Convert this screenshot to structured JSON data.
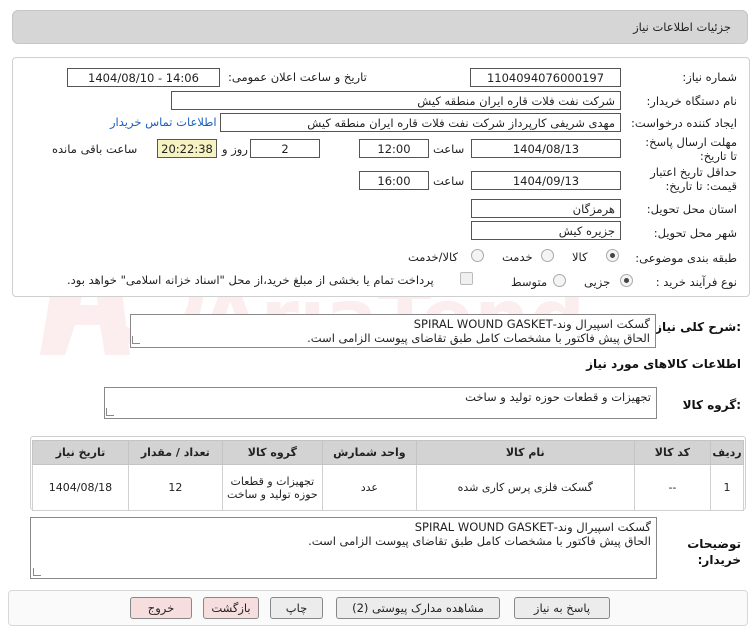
{
  "header": {
    "title": "جزئیات اطلاعات نیاز"
  },
  "form": {
    "need_number_label": "شماره نیاز:",
    "need_number": "1104094076000197",
    "announce_label": "تاریخ و ساعت اعلان عمومی:",
    "announce_value": "1404/08/10 - 14:06",
    "buyer_org_label": "نام دستگاه خریدار:",
    "buyer_org": "شرکت نفت فلات قاره ایران منطقه کیش",
    "creator_label": "ایجاد کننده درخواست:",
    "creator": "مهدی شریفی کارپرداز شرکت نفت فلات قاره ایران منطقه کیش",
    "contact_link": "اطلاعات تماس خریدار",
    "deadline_label": "مهلت ارسال پاسخ: تا تاریخ:",
    "deadline_date": "1404/08/13",
    "time_label": "ساعت",
    "deadline_time": "12:00",
    "days_value": "2",
    "days_label": "روز و",
    "remaining_time": "20:22:38",
    "remaining_label": "ساعت باقی مانده",
    "validity_label": "حداقل تاریخ اعتبار قیمت: تا تاریخ:",
    "validity_date": "1404/09/13",
    "validity_time_label": "ساعت",
    "validity_time": "16:00",
    "province_label": "استان محل تحویل:",
    "province": "هرمزگان",
    "city_label": "شهر محل تحویل:",
    "city": "جزیره کیش",
    "category_label": "طبقه بندی موضوعی:",
    "category_options": [
      "کالا",
      "خدمت",
      "کالا/خدمت"
    ],
    "process_label": "نوع فرآیند خرید :",
    "process_options": [
      "جزیی",
      "متوسط"
    ],
    "payment_note": "پرداخت تمام یا بخشی از مبلغ خرید،از محل \"اسناد خزانه اسلامی\" خواهد بود."
  },
  "description": {
    "label": "شرح کلی نیاز:",
    "text": "گسکت اسپیرال وند-SPIRAL WOUND GASKET\nالحاق پیش فاکتور با مشخصات کامل طبق تقاضای پیوست الزامی است."
  },
  "goods_info": {
    "title": "اطلاعات کالاهای مورد نیاز",
    "group_label": "گروه کالا:",
    "group_value": "تجهیزات و قطعات حوزه تولید و ساخت"
  },
  "table": {
    "headers": [
      "ردیف",
      "کد کالا",
      "نام کالا",
      "واحد شمارش",
      "گروه کالا",
      "تعداد / مقدار",
      "تاریخ نیاز"
    ],
    "rows": [
      {
        "row": "1",
        "code": "--",
        "name": "گسکت فلزی پرس کاری شده",
        "unit": "عدد",
        "group": "تجهیزات و قطعات حوزه تولید و ساخت",
        "qty": "12",
        "date": "1404/08/18"
      }
    ]
  },
  "buyer_notes": {
    "label": "توضیحات خریدار:",
    "text": "گسکت اسپیرال وند-SPIRAL WOUND GASKET\nالحاق پیش فاکتور با مشخصات کامل طبق تقاضای پیوست الزامی است."
  },
  "buttons": {
    "reply": "پاسخ به نیاز",
    "view_docs": "مشاهده مدارک پیوستی (2)",
    "print": "چاپ",
    "back": "بازگشت",
    "exit": "خروج"
  },
  "watermark": {
    "brand": "AriaTender.neT"
  },
  "colors": {
    "header_bg": "#d6d6d6",
    "link": "#1a5fc0",
    "highlight": "#f6f2c2",
    "watermark": "#e05050"
  }
}
